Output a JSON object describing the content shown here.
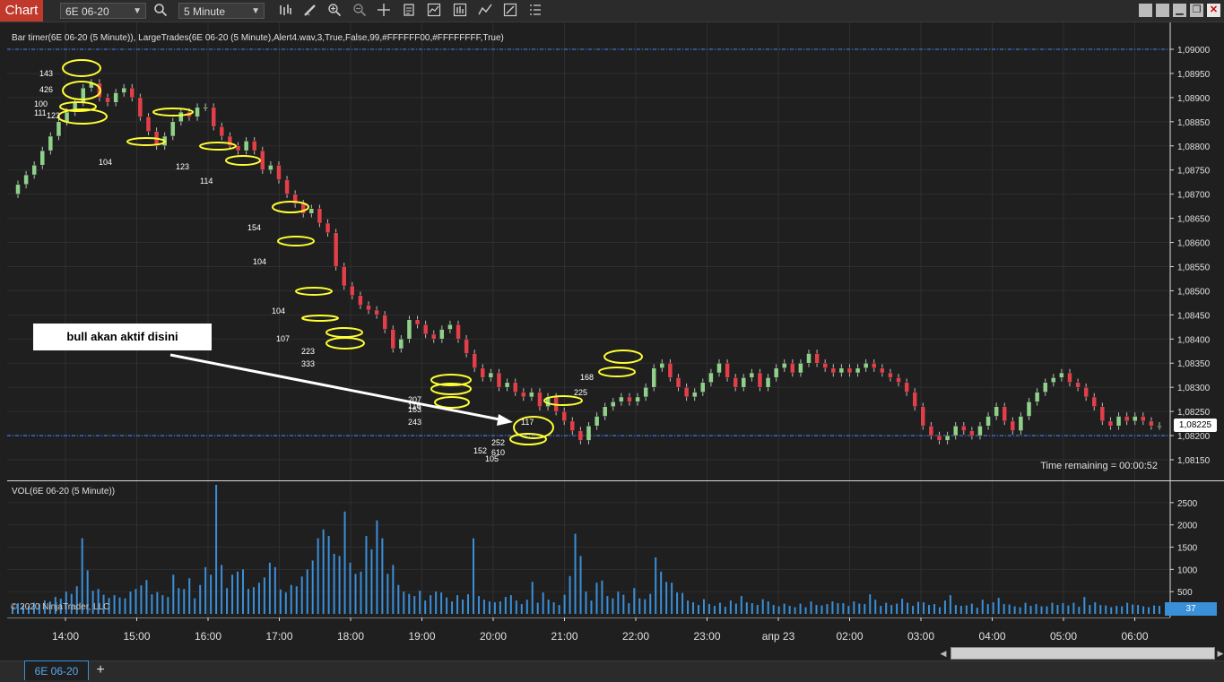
{
  "toolbar": {
    "chart_tab": "Chart",
    "instrument": "6E 06-20",
    "interval": "5 Minute",
    "icons": [
      "search-icon",
      "bar-type-icon",
      "drawing-tool-icon",
      "zoom-in-icon",
      "zoom-out-icon",
      "crosshair-icon",
      "data-box-icon",
      "indicators-icon",
      "strategies-icon",
      "templates-icon",
      "properties-icon"
    ],
    "window_buttons": [
      "minimize",
      "restore",
      "maximize",
      "close"
    ]
  },
  "price_panel": {
    "indicator_label": "Bar timer(6E 06-20 (5 Minute)), LargeTrades(6E 06-20 (5 Minute),Alert4.wav,3,True,False,99,#FFFFFF00,#FFFFFFFF,True)",
    "price_ticks": [
      "1,09000",
      "1,08950",
      "1,08900",
      "1,08850",
      "1,08800",
      "1,08750",
      "1,08700",
      "1,08650",
      "1,08600",
      "1,08550",
      "1,08500",
      "1,08450",
      "1,08400",
      "1,08350",
      "1,08300",
      "1,08250",
      "1,08200",
      "1,08150"
    ],
    "current_price": "1,08225",
    "time_remaining": "Time remaining = 00:00:52",
    "annotation": "bull akan aktif disini",
    "large_trade_labels": [
      "143",
      "426",
      "100",
      "111",
      "123",
      "104",
      "123",
      "114",
      "154",
      "104",
      "104",
      "107",
      "223",
      "333",
      "207",
      "116",
      "163",
      "243",
      "117",
      "152",
      "252",
      "610",
      "105",
      "168",
      "225"
    ]
  },
  "volume_panel": {
    "label": "VOL(6E 06-20 (5 Minute))",
    "ticks": [
      "2500",
      "2000",
      "1500",
      "1000",
      "500"
    ],
    "current_volume": "37",
    "copyright": "© 2020 NinjaTrader, LLC"
  },
  "time_axis": [
    "14:00",
    "15:00",
    "16:00",
    "17:00",
    "18:00",
    "19:00",
    "20:00",
    "21:00",
    "22:00",
    "23:00",
    "апр 23",
    "02:00",
    "03:00",
    "04:00",
    "05:00",
    "06:00"
  ],
  "bottom_bar": {
    "instrument_tab": "6E 06-20",
    "add_tab": "+"
  },
  "colors": {
    "up_candle": "#8fd18a",
    "down_candle": "#e0404a",
    "large_trade_ellipse": "#ffff33",
    "volume_bar": "#3a8fd9",
    "chart_tab": "#c0392b",
    "h_line": "#3a70d0"
  },
  "chart_data": [
    {
      "type": "candlestick",
      "title": "",
      "x_ticks": [
        "14:00",
        "15:00",
        "16:00",
        "17:00",
        "18:00",
        "19:00",
        "20:00",
        "21:00",
        "22:00",
        "23:00",
        "апр 23",
        "02:00",
        "03:00",
        "04:00",
        "05:00",
        "06:00"
      ],
      "ylim": [
        1.08125,
        1.09025
      ],
      "horizontal_lines": [
        1.09,
        1.082
      ],
      "close_series": [
        1.0872,
        1.0874,
        1.0876,
        1.0879,
        1.0882,
        1.0885,
        1.0887,
        1.0889,
        1.0892,
        1.0893,
        1.089,
        1.0889,
        1.0891,
        1.0892,
        1.089,
        1.0886,
        1.0883,
        1.088,
        1.0882,
        1.0885,
        1.0887,
        1.0886,
        1.0888,
        1.0888,
        1.0884,
        1.0882,
        1.088,
        1.0879,
        1.0881,
        1.0879,
        1.0875,
        1.0876,
        1.0873,
        1.087,
        1.0868,
        1.0866,
        1.0867,
        1.0864,
        1.0862,
        1.0855,
        1.0851,
        1.0849,
        1.0847,
        1.0846,
        1.0845,
        1.0842,
        1.0838,
        1.084,
        1.0844,
        1.0843,
        1.0841,
        1.084,
        1.0842,
        1.0843,
        1.084,
        1.0837,
        1.0834,
        1.0832,
        1.0833,
        1.083,
        1.0831,
        1.0829,
        1.0828,
        1.0829,
        1.0826,
        1.0828,
        1.0825,
        1.0823,
        1.0821,
        1.0819,
        1.0822,
        1.0824,
        1.0826,
        1.0827,
        1.0828,
        1.0827,
        1.0828,
        1.083,
        1.0834,
        1.0835,
        1.0832,
        1.083,
        1.0828,
        1.0829,
        1.0831,
        1.0833,
        1.0835,
        1.0832,
        1.083,
        1.0832,
        1.0833,
        1.083,
        1.0832,
        1.0834,
        1.0835,
        1.0833,
        1.0835,
        1.0837,
        1.0835,
        1.0834,
        1.0833,
        1.0834,
        1.0833,
        1.0834,
        1.0835,
        1.0834,
        1.0833,
        1.0832,
        1.0831,
        1.0829,
        1.0826,
        1.0822,
        1.082,
        1.0819,
        1.082,
        1.0822,
        1.0821,
        1.082,
        1.0822,
        1.0824,
        1.0826,
        1.0823,
        1.0821,
        1.0824,
        1.0827,
        1.0829,
        1.0831,
        1.0832,
        1.0833,
        1.0831,
        1.083,
        1.0828,
        1.0826,
        1.0823,
        1.0822,
        1.0824,
        1.0823,
        1.0824,
        1.0823,
        1.0822,
        1.0822
      ]
    },
    {
      "type": "bar",
      "title": "",
      "ylim": [
        0,
        2900
      ],
      "y_ticks": [
        500,
        1000,
        1500,
        2000,
        2500
      ],
      "values": [
        170,
        240,
        200,
        180,
        250,
        230,
        300,
        280,
        380,
        340,
        500,
        450,
        620,
        1700,
        980,
        520,
        560,
        430,
        360,
        420,
        370,
        350,
        500,
        560,
        640,
        760,
        440,
        490,
        420,
        380,
        880,
        580,
        560,
        800,
        350,
        650,
        1050,
        880,
        2900,
        1100,
        580,
        880,
        950,
        1000,
        560,
        600,
        700,
        820,
        1150,
        1050,
        550,
        480,
        650,
        620,
        840,
        1000,
        1200,
        1700,
        1900,
        1750,
        1350,
        1300,
        2300,
        1150,
        900,
        950,
        1750,
        1450,
        2100,
        1700,
        900,
        1100,
        650,
        500,
        450,
        400,
        520,
        300,
        420,
        500,
        480,
        370,
        280,
        420,
        320,
        440,
        1700,
        400,
        320,
        280,
        260,
        280,
        380,
        420,
        300,
        220,
        320,
        720,
        250,
        480,
        320,
        260,
        200,
        430,
        850,
        1800,
        1300,
        500,
        300,
        700,
        750,
        400,
        350,
        500,
        430,
        240,
        580,
        350,
        330,
        450,
        1270,
        950,
        720,
        700,
        480,
        470,
        300,
        260,
        200,
        330,
        220,
        180,
        250,
        160,
        300,
        230,
        400,
        260,
        240,
        200,
        330,
        280,
        200,
        170,
        230,
        180,
        150,
        230,
        150,
        280,
        200,
        190,
        220,
        280,
        240,
        240,
        180,
        280,
        230,
        220,
        440,
        320,
        180,
        250,
        200,
        230,
        340,
        250,
        180,
        270,
        260,
        200,
        220,
        150,
        300,
        420,
        200,
        180,
        190,
        230,
        140,
        320,
        220,
        260,
        360,
        220,
        210,
        170,
        150,
        250,
        180,
        220,
        170,
        170,
        250,
        200,
        240,
        190,
        250,
        160,
        380,
        200,
        260,
        200,
        190,
        150,
        180,
        170,
        250,
        210,
        200,
        170,
        150,
        190,
        180
      ]
    }
  ]
}
